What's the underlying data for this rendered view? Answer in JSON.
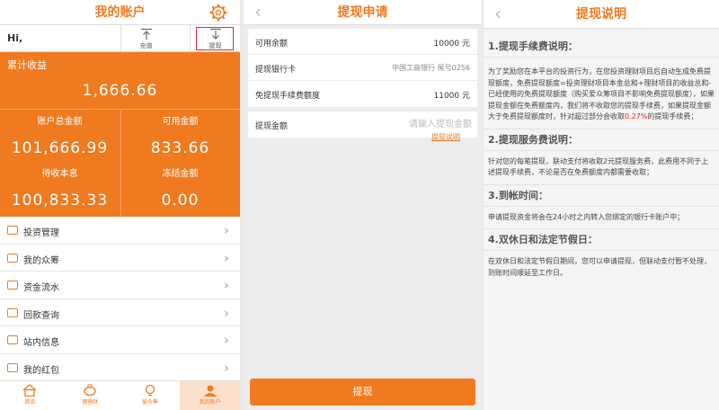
{
  "account": {
    "title": "我的账户",
    "greeting": "Hi,",
    "charge_label": "充值",
    "withdraw_label": "提现",
    "cumulative_label": "累计收益",
    "cumulative_value": "1,666.66",
    "stats": [
      {
        "label": "账户总金额",
        "value": "101,666.99"
      },
      {
        "label": "可用金额",
        "value": "833.66"
      },
      {
        "label": "待收本息",
        "value": "100,833.33"
      },
      {
        "label": "冻结金额",
        "value": "0.00"
      }
    ],
    "menu": [
      "投资管理",
      "我的众筹",
      "资金流水",
      "回款查询",
      "站内信息",
      "我的红包"
    ],
    "tabs": [
      "首页",
      "理理财",
      "爱众筹",
      "我的账户"
    ]
  },
  "withdraw": {
    "title": "提现申请",
    "available_label": "可用余额",
    "available_value": "10000 元",
    "bank_label": "提现银行卡",
    "bank_value": "中国工商银行 尾号0256",
    "free_label": "免提现手续费额度",
    "free_value": "11000 元",
    "amount_label": "提现金额",
    "amount_placeholder": "请输入提现金额",
    "explain_link": "提现说明",
    "submit_label": "提现"
  },
  "explain": {
    "title": "提现说明",
    "sections": [
      {
        "heading": "1.提现手续费说明：",
        "body_pre": "为了奖励您在本平台的投资行为，在您投资理财项目后自动生成免费提现额度，免费提现额度=投资理财项目本金总和+理财项目的收益总和-已经使用的免费提现额度（购买爱众筹项目不影响免费提现额度），如果提现金额在免费额度内，我们将不收取您的提现手续费，如果提现金额大于免费提现额度时，针对超过部分会收取",
        "body_red": "0.27%",
        "body_post": "的提现手续费；"
      },
      {
        "heading": "2.提现服务费说明：",
        "body_pre": "针对您的每笔提现，联动支付将收取2元提现服务费，此费用不同于上述提现手续费，不论是否在免费额度内都需要收取；",
        "body_red": "",
        "body_post": ""
      },
      {
        "heading": "3.到帐时间：",
        "body_pre": "申请提现资金将会在24小时之内转入您绑定的银行卡账户中；",
        "body_red": "",
        "body_post": ""
      },
      {
        "heading": "4.双休日和法定节假日：",
        "body_pre": "在双休日和法定节假日期间，您可以申请提现，但联动支付暂不处理，到账时间顺延至工作日。",
        "body_red": "",
        "body_post": ""
      }
    ]
  },
  "colors": {
    "accent": "#ef7a1f",
    "highlight_red": "#e22233"
  }
}
